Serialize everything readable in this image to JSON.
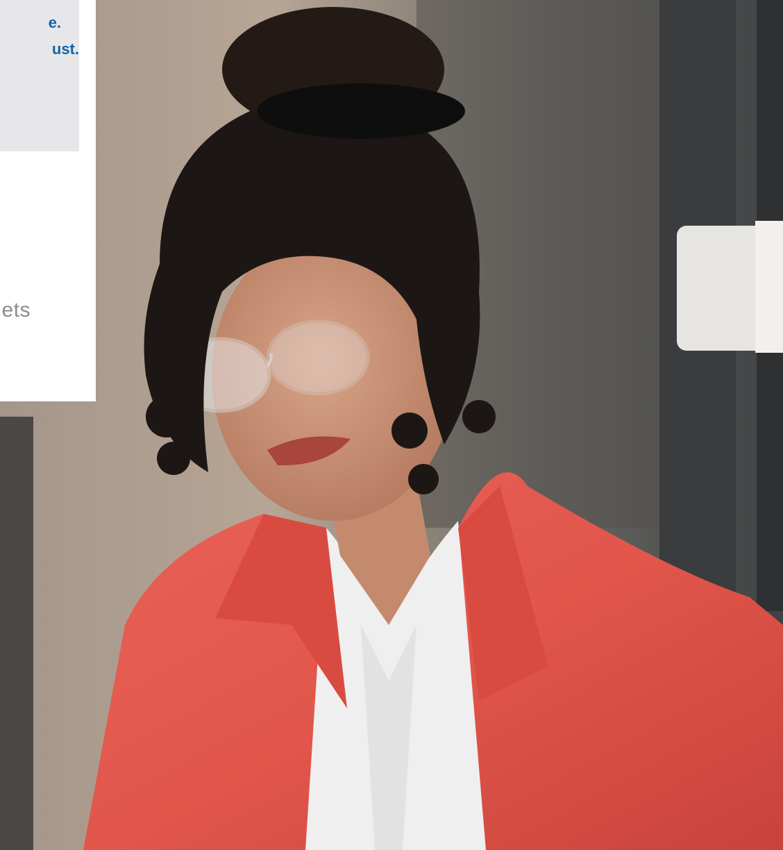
{
  "card": {
    "quote_lines": [
      "e.",
      "ust."
    ],
    "body_fragment": "ets"
  },
  "photo": {
    "subject": "woman-portrait"
  },
  "colors": {
    "quote_text": "#1164a9",
    "quote_box": "#e7e7e9",
    "card_bg": "#ffffff",
    "body_text": "#8b8b8b",
    "jacket": "#e25248",
    "shirt": "#eeeeee"
  }
}
